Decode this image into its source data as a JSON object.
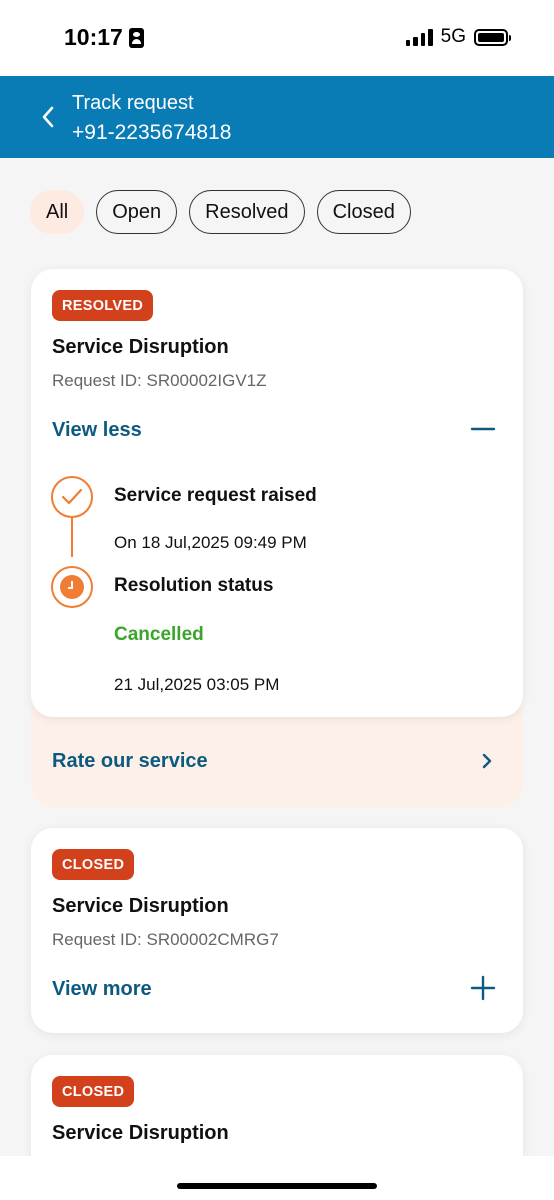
{
  "status_bar": {
    "time": "10:17",
    "network": "5G"
  },
  "header": {
    "title": "Track request",
    "subtitle": "+91-2235674818"
  },
  "filters": [
    "All",
    "Open",
    "Resolved",
    "Closed"
  ],
  "requests": [
    {
      "badge": "RESOLVED",
      "title": "Service Disruption",
      "request_id": "Request ID: SR00002IGV1Z",
      "toggle_label": "View less",
      "timeline": {
        "raised_heading": "Service request raised",
        "raised_date": "On 18 Jul,2025 09:49 PM",
        "resolution_heading": "Resolution status",
        "resolution_status": "Cancelled",
        "resolution_date": "21 Jul,2025 03:05 PM"
      },
      "rate_label": "Rate our service"
    },
    {
      "badge": "CLOSED",
      "title": "Service Disruption",
      "request_id": "Request ID: SR00002CMRG7",
      "toggle_label": "View more"
    },
    {
      "badge": "CLOSED",
      "title": "Service Disruption"
    }
  ],
  "colors": {
    "header_bg": "#0a7cb5",
    "badge_bg": "#d2401c",
    "link": "#0d5a80",
    "timeline_accent": "#f07d33",
    "status_cancelled": "#3aa52a",
    "chip_active_bg": "#fdebe2",
    "rate_card_bg": "#fdf0e9"
  }
}
